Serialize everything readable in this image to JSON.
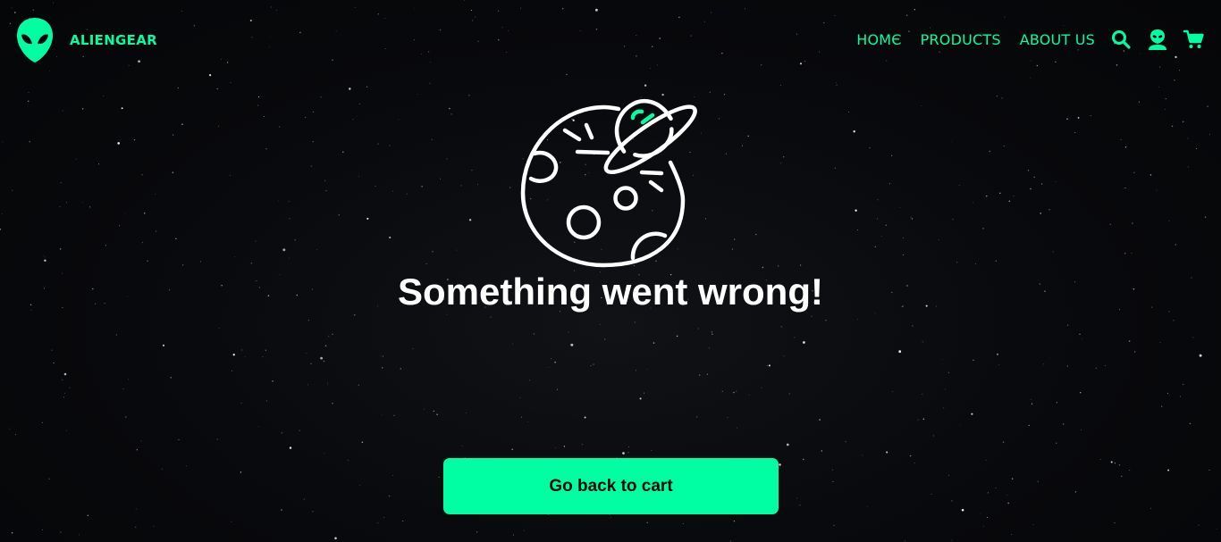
{
  "brand": {
    "name": "ALIENGEAR",
    "logo_icon": "alien-head-icon",
    "accent_color": "#00ffa3"
  },
  "nav": {
    "links": [
      {
        "label": "HOMЄ"
      },
      {
        "label": "PRODUCTS"
      },
      {
        "label": "ABOUT US"
      }
    ],
    "icons": [
      "search-icon",
      "account-alien-icon",
      "cart-icon"
    ]
  },
  "error": {
    "illustration": "ufo-crashed-planet-icon",
    "headline": "Something went wrong!",
    "button_label": "Go back to cart"
  },
  "colors": {
    "background": "#07080b",
    "accent": "#00ffa3",
    "text": "#ffffff"
  }
}
